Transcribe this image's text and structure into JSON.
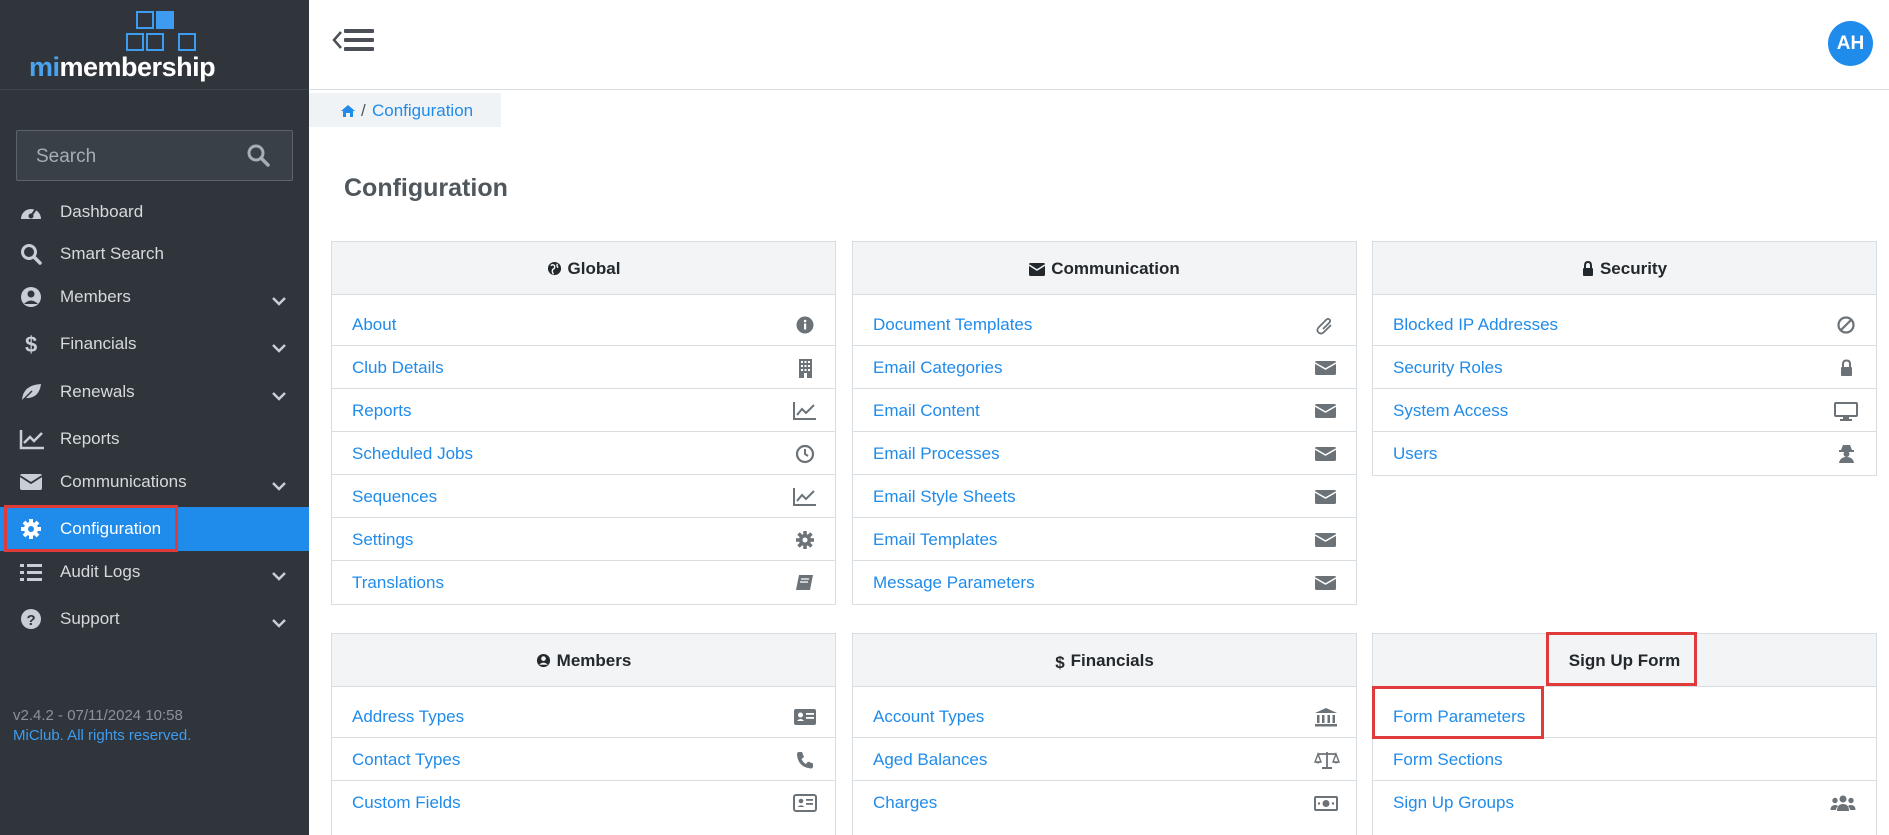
{
  "app": {
    "logo_prefix": "mi",
    "logo_suffix": "membership",
    "colors": {
      "sidebar": "#2f353b",
      "accent": "#1f8bea",
      "highlight": "#e03b3b"
    }
  },
  "sidebar": {
    "search_placeholder": "Search",
    "items": [
      {
        "label": "Dashboard",
        "icon": "dashboard-icon"
      },
      {
        "label": "Smart Search",
        "icon": "search-icon"
      },
      {
        "label": "Members",
        "icon": "user-circle-icon",
        "expandable": true
      },
      {
        "label": "Financials",
        "icon": "dollar-icon",
        "expandable": true
      },
      {
        "label": "Renewals",
        "icon": "leaf-icon",
        "expandable": true
      },
      {
        "label": "Reports",
        "icon": "line-chart-icon"
      },
      {
        "label": "Communications",
        "icon": "envelope-icon",
        "expandable": true
      },
      {
        "label": "Configuration",
        "icon": "gear-icon",
        "active": true
      },
      {
        "label": "Audit Logs",
        "icon": "list-icon",
        "expandable": true
      },
      {
        "label": "Support",
        "icon": "question-icon",
        "expandable": true
      }
    ],
    "version": "v2.4.2 - 07/11/2024 10:58",
    "rights": "MiClub. All rights reserved."
  },
  "header": {
    "avatar_initials": "AH"
  },
  "breadcrumb": {
    "current": "Configuration"
  },
  "page": {
    "title": "Configuration"
  },
  "cards": {
    "global": {
      "title": "Global",
      "rows": [
        {
          "label": "About",
          "icon": "info-icon"
        },
        {
          "label": "Club Details",
          "icon": "building-icon"
        },
        {
          "label": "Reports",
          "icon": "line-chart-icon"
        },
        {
          "label": "Scheduled Jobs",
          "icon": "clock-icon"
        },
        {
          "label": "Sequences",
          "icon": "line-chart-icon"
        },
        {
          "label": "Settings",
          "icon": "gear-icon"
        },
        {
          "label": "Translations",
          "icon": "book-icon"
        }
      ]
    },
    "communication": {
      "title": "Communication",
      "rows": [
        {
          "label": "Document Templates",
          "icon": "paperclip-icon"
        },
        {
          "label": "Email Categories",
          "icon": "envelope-icon"
        },
        {
          "label": "Email Content",
          "icon": "envelope-icon"
        },
        {
          "label": "Email Processes",
          "icon": "envelope-icon"
        },
        {
          "label": "Email Style Sheets",
          "icon": "envelope-icon"
        },
        {
          "label": "Email Templates",
          "icon": "envelope-icon"
        },
        {
          "label": "Message Parameters",
          "icon": "envelope-icon"
        }
      ]
    },
    "security": {
      "title": "Security",
      "rows": [
        {
          "label": "Blocked IP Addresses",
          "icon": "ban-icon"
        },
        {
          "label": "Security Roles",
          "icon": "lock-icon"
        },
        {
          "label": "System Access",
          "icon": "desktop-icon"
        },
        {
          "label": "Users",
          "icon": "user-secret-icon"
        }
      ]
    },
    "members": {
      "title": "Members",
      "rows": [
        {
          "label": "Address Types",
          "icon": "address-card-icon"
        },
        {
          "label": "Contact Types",
          "icon": "phone-icon"
        },
        {
          "label": "Custom Fields",
          "icon": "id-card-icon"
        }
      ]
    },
    "financials": {
      "title": "Financials",
      "rows": [
        {
          "label": "Account Types",
          "icon": "bank-icon"
        },
        {
          "label": "Aged Balances",
          "icon": "balance-scale-icon"
        },
        {
          "label": "Charges",
          "icon": "money-icon"
        }
      ]
    },
    "signup": {
      "title": "Sign Up Form",
      "rows": [
        {
          "label": "Form Parameters",
          "icon": ""
        },
        {
          "label": "Form Sections",
          "icon": ""
        },
        {
          "label": "Sign Up Groups",
          "icon": "users-icon"
        }
      ]
    }
  }
}
